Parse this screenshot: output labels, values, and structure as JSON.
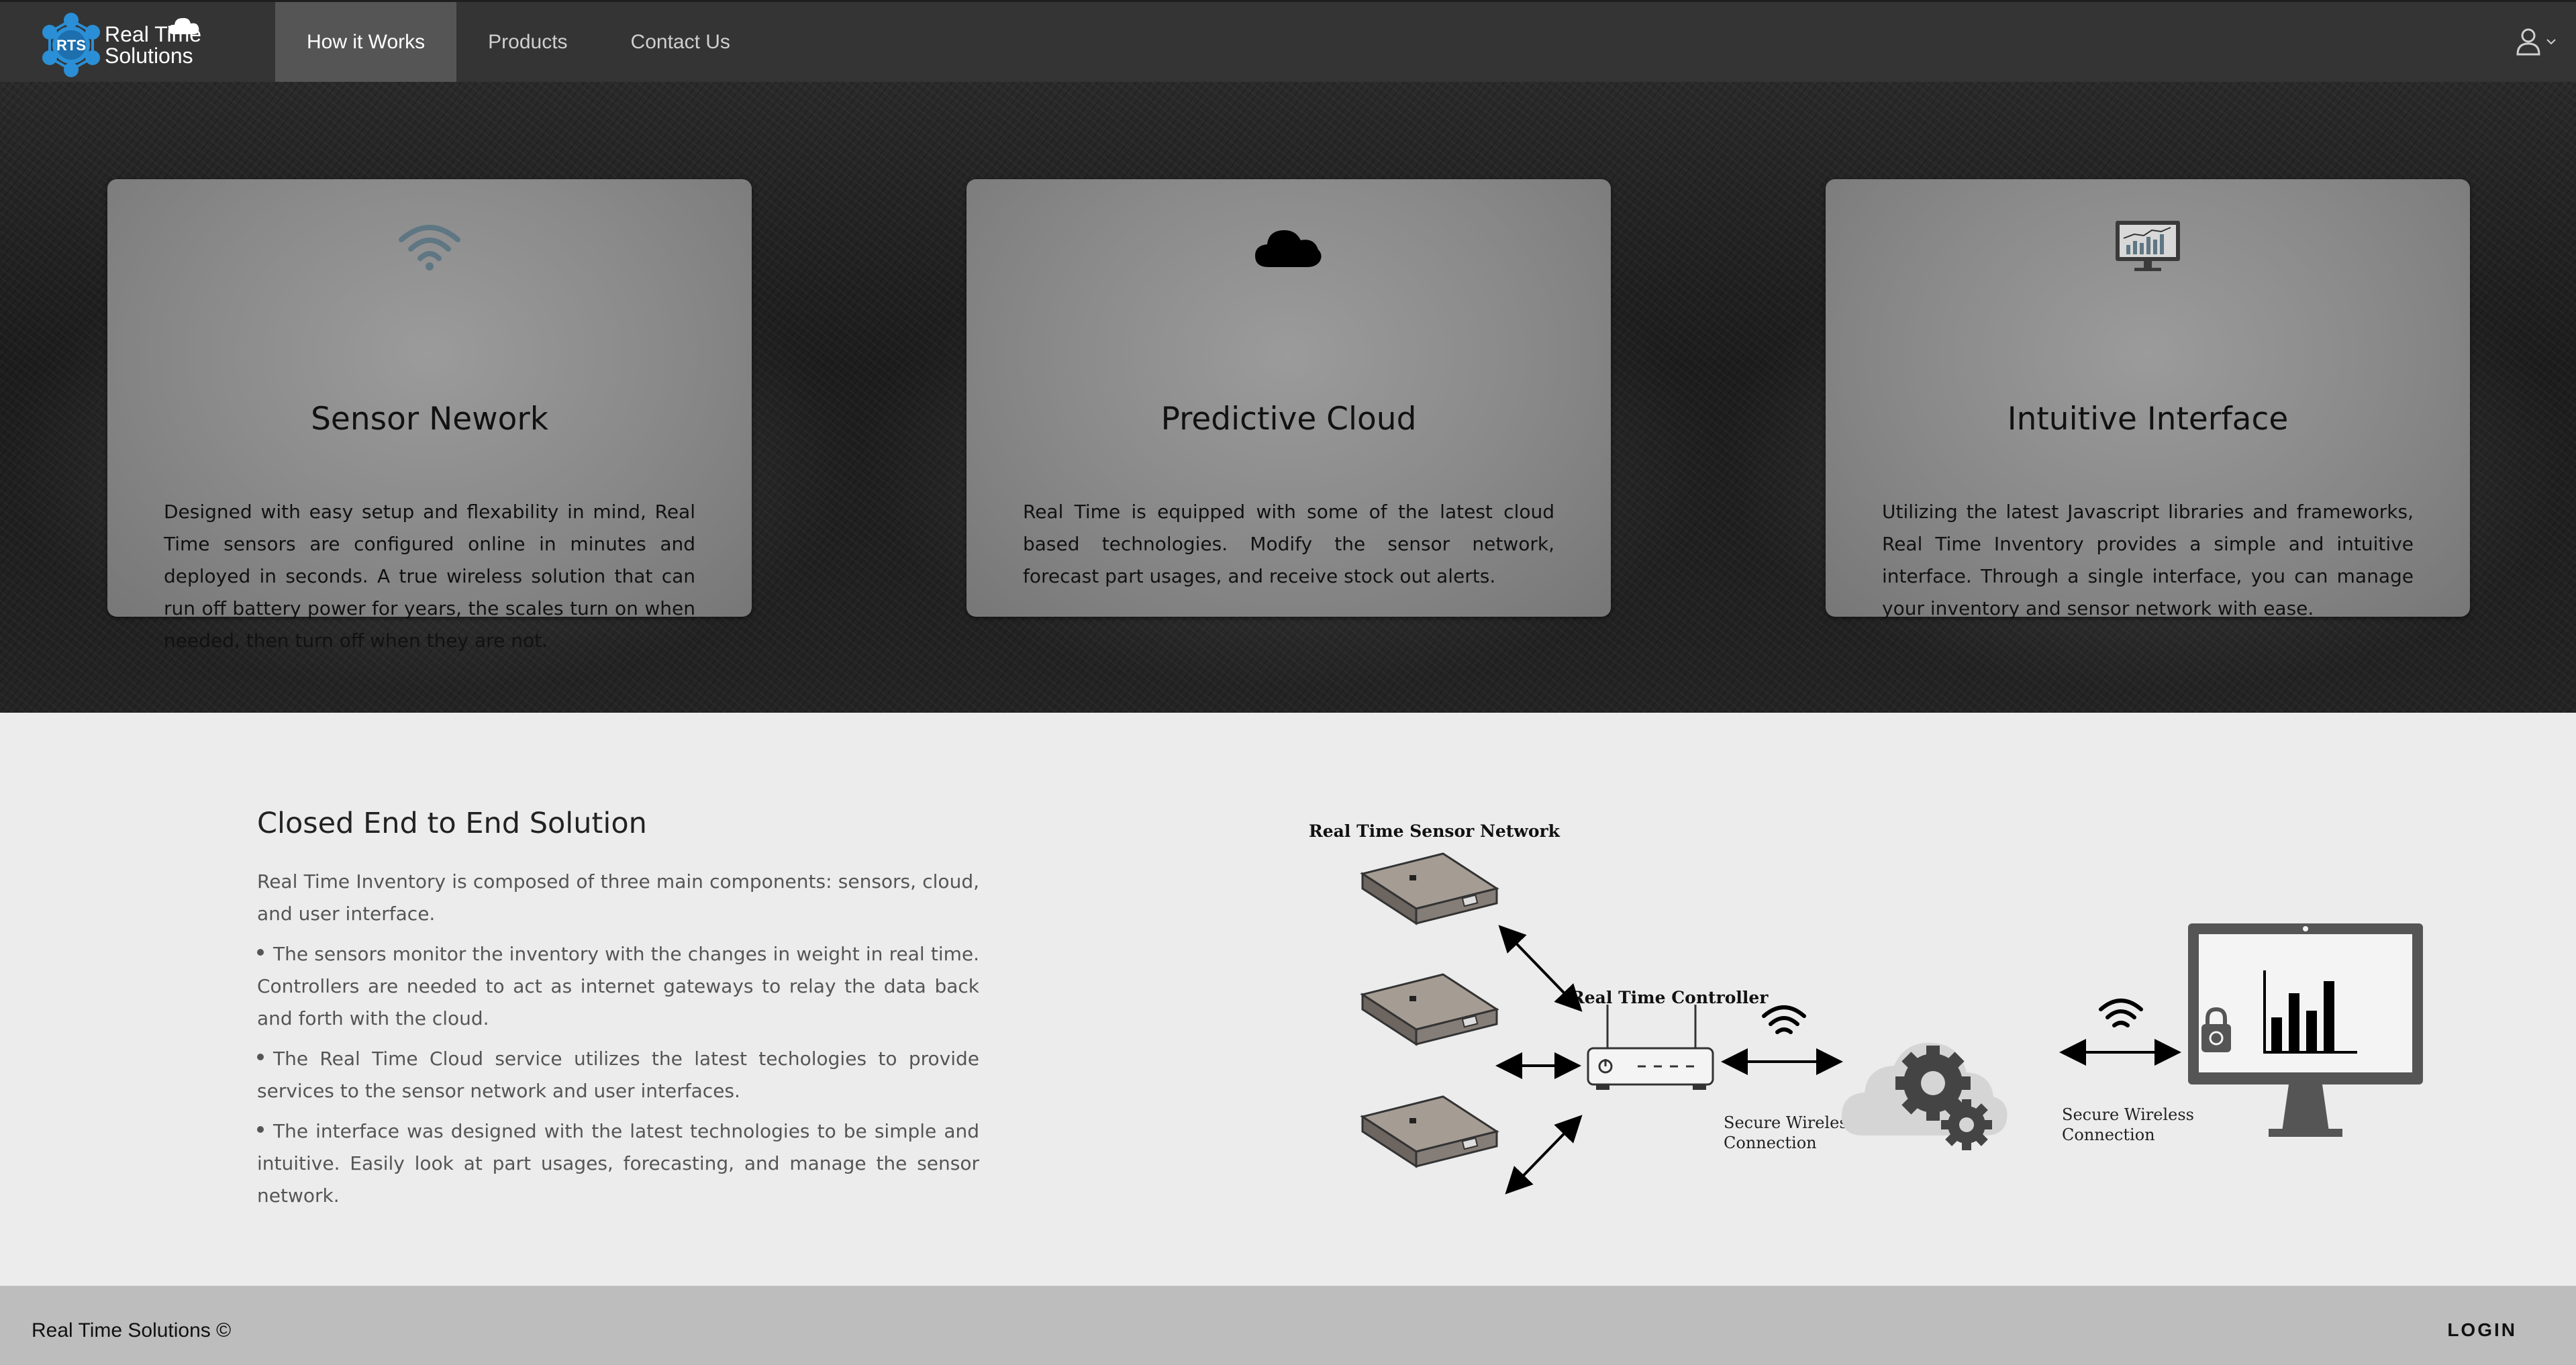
{
  "brand": {
    "logo_text": "RTS",
    "name_line1": "Real Time",
    "name_line2": "Solutions"
  },
  "nav": {
    "tabs": [
      {
        "label": "How it Works",
        "active": true
      },
      {
        "label": "Products",
        "active": false
      },
      {
        "label": "Contact Us",
        "active": false
      }
    ],
    "user_icon": "user-icon"
  },
  "cards": [
    {
      "icon": "wifi-icon",
      "title": "Sensor Nework",
      "body": "Designed with easy setup and flexability in mind, Real Time sensors are configured online in minutes and deployed in seconds. A true wireless solution that can run off battery power for years, the scales turn on when needed, then turn off when they are not."
    },
    {
      "icon": "cloud-icon",
      "title": "Predictive Cloud",
      "body": "Real Time is equipped with some of the latest cloud based technologies. Modify the sensor network, forecast part usages, and receive stock out alerts."
    },
    {
      "icon": "monitor-chart-icon",
      "title": "Intuitive Interface",
      "body": "Utilizing the latest Javascript libraries and frameworks, Real Time Inventory provides a simple and intuitive interface. Through a single interface, you can manage your inventory and sensor network with ease."
    }
  ],
  "solution": {
    "title": "Closed End to End Solution",
    "intro": "Real Time Inventory is composed of three main components: sensors, cloud, and user interface.",
    "bullets": [
      "The sensors monitor the inventory with the changes in weight in real time. Controllers are needed to act as internet gateways to relay the data back and forth with the cloud.",
      "The Real Time Cloud service utilizes the latest techologies to provide services to the sensor network and user interfaces.",
      "The interface was designed with the latest technologies to be simple and intuitive. Easily look at part usages, forecasting, and manage the sensor network."
    ]
  },
  "diagram": {
    "sensor_network_label": "Real Time Sensor Network",
    "controller_label": "Real Time Controller",
    "connection_left": "Secure Wireless Connection",
    "connection_right": "Secure Wireless Connection"
  },
  "footer": {
    "copyright": "Real Time Solutions ©",
    "login": "LOGIN"
  },
  "colors": {
    "navbar": "#343434",
    "nav_active": "#555555",
    "brand_blue": "#2a8fd6",
    "section_bg": "#ececec",
    "footer_bg": "#bdbdbd"
  }
}
